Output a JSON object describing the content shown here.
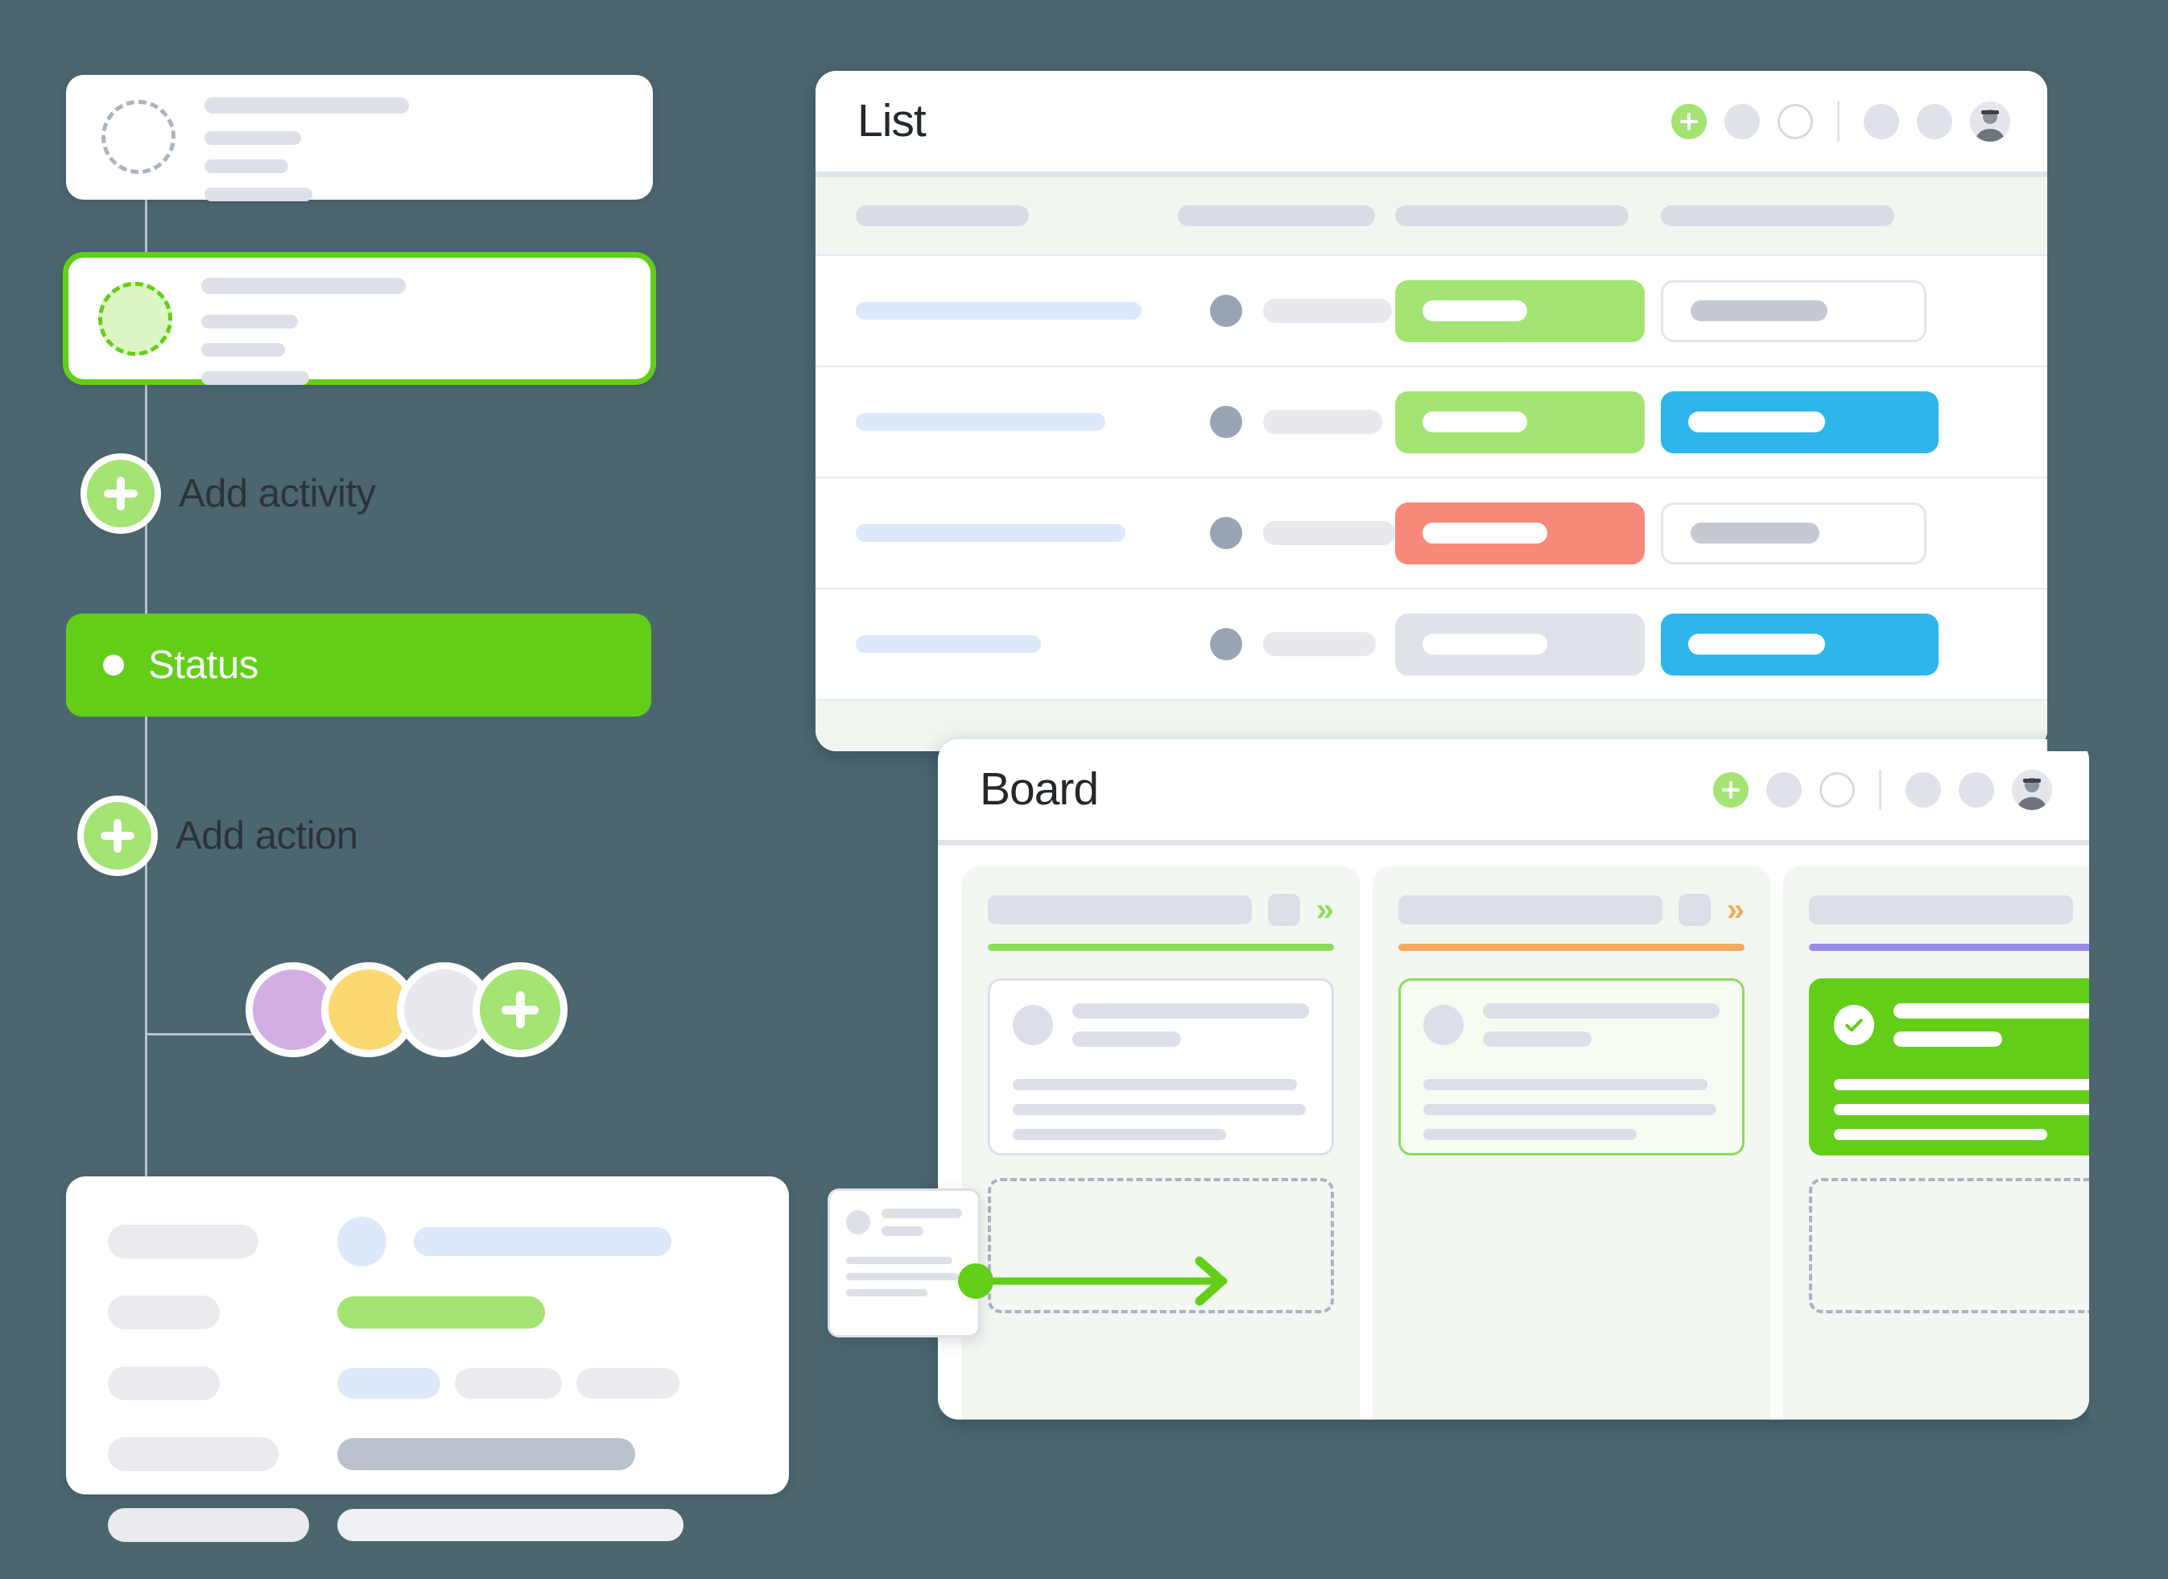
{
  "theme": {
    "background": "#4c6670",
    "accent_green": "#63ce18",
    "accent_light_green": "#a3e472",
    "chip_blue": "#2eb5ec",
    "chip_red": "#f8897a",
    "chip_gray": "#dfe2e9",
    "column_green": "#8cdc5b",
    "column_orange": "#f5a95c",
    "column_purple": "#9b8ce8",
    "skeleton_gray": "#dcdfe8",
    "soft_blue": "#dde8fb",
    "panel_tint": "#f2f7f1"
  },
  "flow": {
    "activity_card": {
      "avatar_icon": "dashed-avatar-placeholder-icon",
      "line_widths": [
        "380",
        "240",
        "200",
        "230"
      ]
    },
    "selected_activity_card": {
      "avatar_icon": "dashed-avatar-selected-icon",
      "line_widths": [
        "380",
        "240",
        "200",
        "230"
      ],
      "selected": true
    },
    "add_activity": {
      "label": "Add activity",
      "icon": "plus-icon"
    },
    "status": {
      "label": "Status",
      "dot_icon": "status-dot-icon"
    },
    "add_action": {
      "label": "Add action",
      "icon": "plus-icon"
    },
    "assignees": [
      {
        "name": "assignee-purple",
        "color": "#d3aee5"
      },
      {
        "name": "assignee-yellow",
        "color": "#fbd970"
      },
      {
        "name": "assignee-gray",
        "color": "#e7e9ee"
      },
      {
        "name": "add-assignee",
        "color": "#a3e472",
        "icon": "plus-icon"
      }
    ],
    "detail_card": {
      "rows": [
        {
          "label_w": "200",
          "value_kind": "avatar-and-bar",
          "value_w": "370",
          "value_color": "#dde8fb"
        },
        {
          "label_w": "155",
          "value_kind": "bar",
          "value_w": "260",
          "value_color": "#a3e472"
        },
        {
          "label_w": "155",
          "value_kind": "three-bars",
          "value_w": "130",
          "value_color": "#dde8fb"
        },
        {
          "label_w": "230",
          "value_kind": "bar",
          "value_w": "375",
          "value_color": "#bcc2cd"
        },
        {
          "label_w": "270",
          "value_kind": "bar",
          "value_w": "435",
          "value_color": "#f0f1f4"
        }
      ]
    }
  },
  "list_window": {
    "title": "List",
    "controls": [
      {
        "name": "add-button",
        "icon": "plus-icon",
        "style": "green"
      },
      {
        "name": "filter-dot",
        "icon": "dot-icon",
        "style": "gray"
      },
      {
        "name": "outline-dot",
        "icon": "circle-outline-icon",
        "style": "ring"
      },
      {
        "name": "divider",
        "icon": "divider-icon",
        "style": "divider"
      },
      {
        "name": "settings-dot",
        "icon": "dot-icon",
        "style": "gray"
      },
      {
        "name": "more-dot",
        "icon": "dot-icon",
        "style": "gray"
      },
      {
        "name": "user-avatar",
        "icon": "avatar-photo-icon",
        "style": "photo"
      }
    ],
    "columns": [
      "col-name",
      "col-assignee",
      "col-status",
      "col-tag"
    ],
    "header_widths": [
      "215",
      "330",
      "295",
      "290"
    ],
    "rows": [
      {
        "name_w": "355",
        "assignee_w": "165",
        "status": {
          "kind": "green",
          "label_w": "130"
        },
        "tag": {
          "kind": "outline",
          "label_w": "170"
        }
      },
      {
        "name_w": "310",
        "assignee_w": "150",
        "status": {
          "kind": "green",
          "label_w": "130"
        },
        "tag": {
          "kind": "blue",
          "label_w": "175"
        }
      },
      {
        "name_w": "335",
        "assignee_w": "205",
        "status": {
          "kind": "red",
          "label_w": "155"
        },
        "tag": {
          "kind": "outline",
          "label_w": "160"
        }
      },
      {
        "name_w": "230",
        "assignee_w": "140",
        "status": {
          "kind": "gray",
          "label_w": "155"
        },
        "tag": {
          "kind": "blue",
          "label_w": "175"
        }
      }
    ]
  },
  "board_window": {
    "title": "Board",
    "controls": [
      {
        "name": "add-button",
        "icon": "plus-icon",
        "style": "green"
      },
      {
        "name": "filter-dot",
        "icon": "dot-icon",
        "style": "gray"
      },
      {
        "name": "outline-dot",
        "icon": "circle-outline-icon",
        "style": "ring"
      },
      {
        "name": "divider",
        "icon": "divider-icon",
        "style": "divider"
      },
      {
        "name": "settings-dot",
        "icon": "dot-icon",
        "style": "gray"
      },
      {
        "name": "more-dot",
        "icon": "dot-icon",
        "style": "gray"
      },
      {
        "name": "user-avatar",
        "icon": "avatar-photo-icon",
        "style": "photo"
      }
    ],
    "columns": [
      {
        "name": "board-column-1",
        "accent": "#8cdc5b",
        "collapse_icon": "chevron-double-right-icon",
        "card": {
          "state": "default",
          "avatar_icon": "avatar-placeholder-icon"
        },
        "dropzone_label": "drop-zone"
      },
      {
        "name": "board-column-2",
        "accent": "#f5a95c",
        "collapse_icon": "chevron-double-right-icon",
        "card": {
          "state": "selected",
          "avatar_icon": "avatar-placeholder-icon"
        },
        "dropzone_label": "drop-zone"
      },
      {
        "name": "board-column-3",
        "accent": "#9b8ce8",
        "collapse_icon": "chevron-double-right-icon",
        "card": {
          "state": "done",
          "avatar_icon": "check-circle-icon"
        },
        "dropzone_label": "drop-zone"
      }
    ],
    "drag": {
      "card_name": "dragging-card",
      "avatar_icon": "avatar-placeholder-icon",
      "arrow_icon": "arrow-right-icon",
      "handle_icon": "drag-handle-dot-icon"
    }
  }
}
